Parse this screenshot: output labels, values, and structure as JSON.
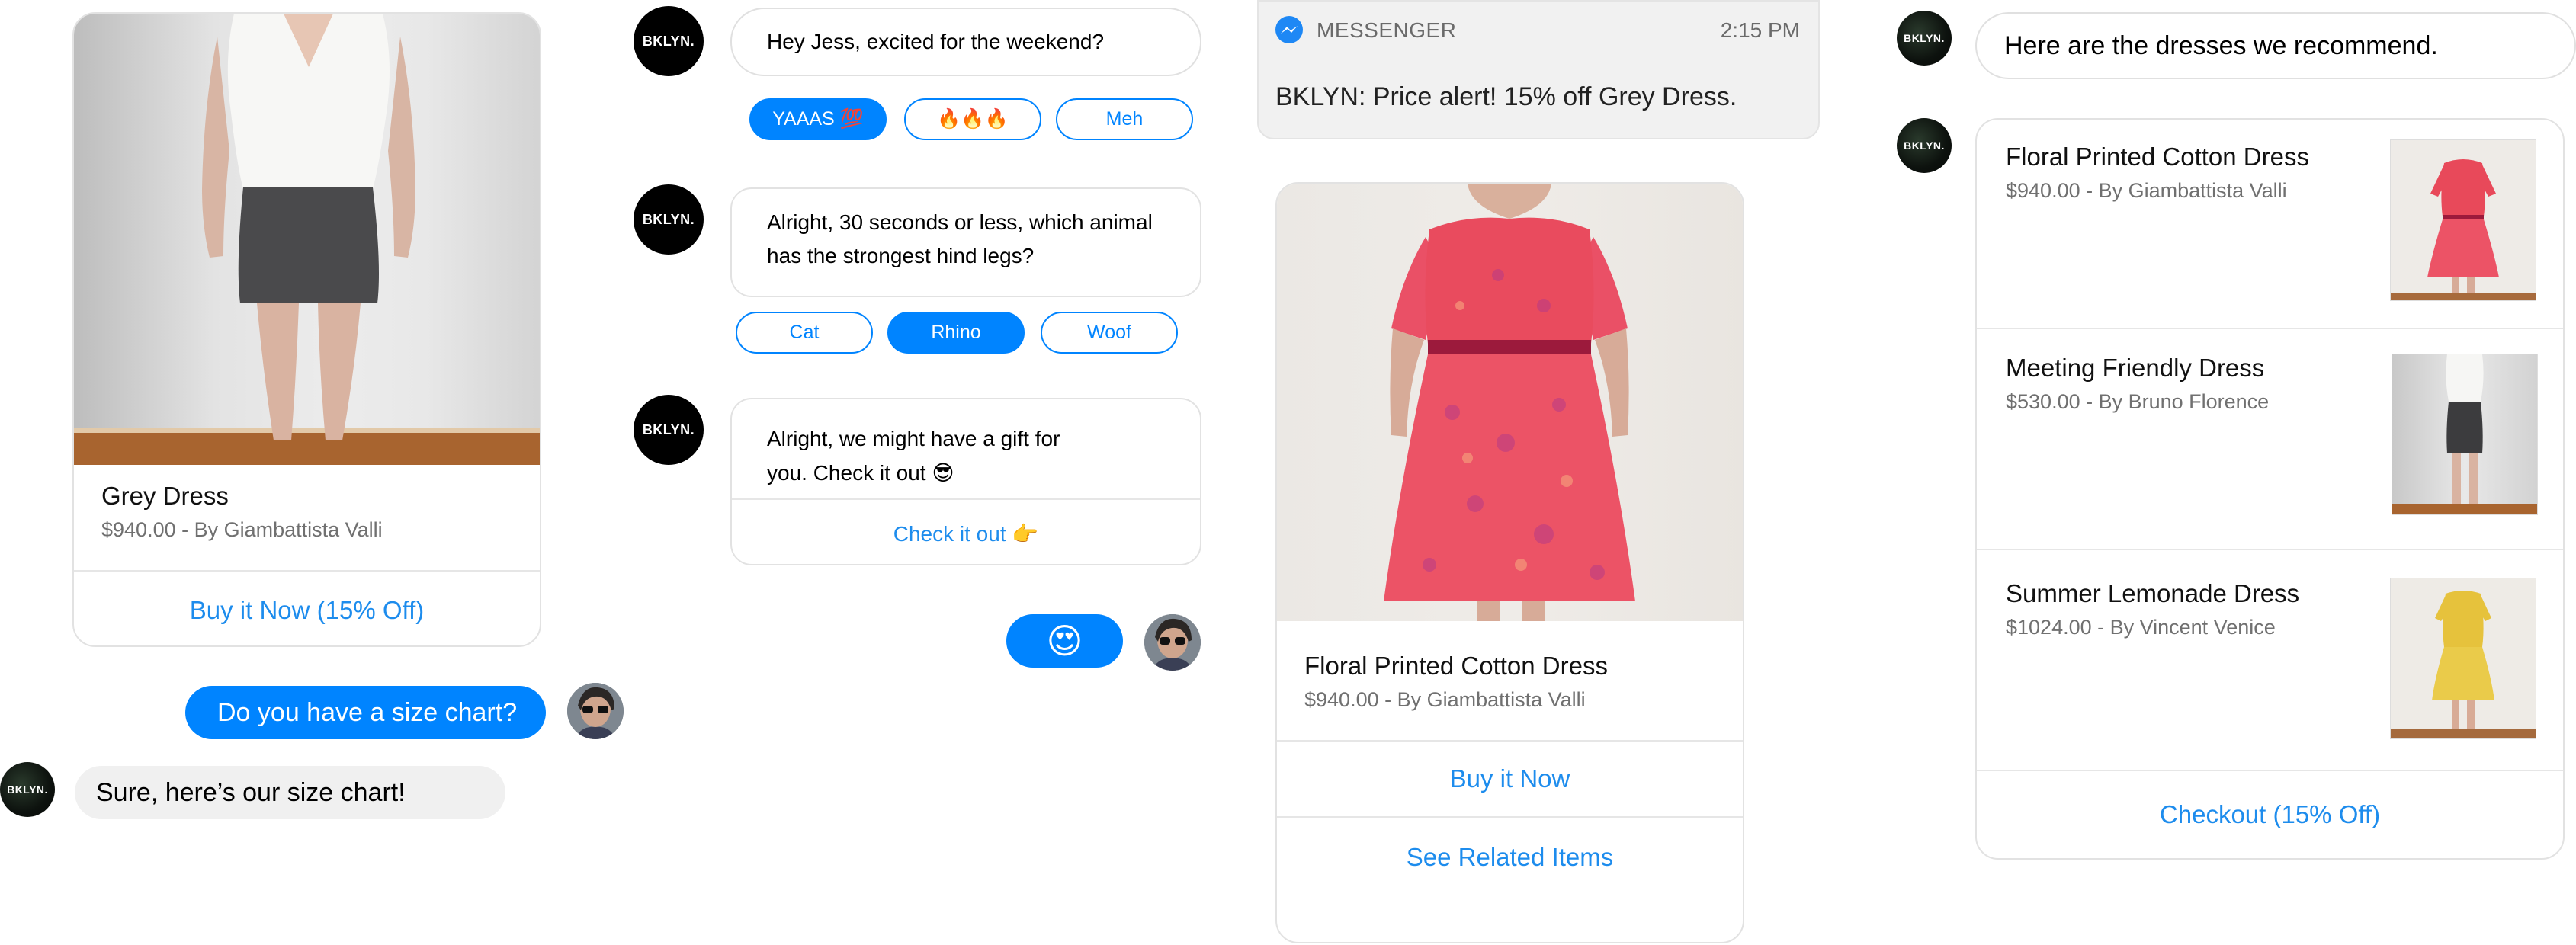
{
  "panel1": {
    "product_card": {
      "title": "Grey Dress",
      "subtitle": "$940.00 - By Giambattista Valli",
      "button": "Buy it Now (15% Off)"
    },
    "user_message": "Do you have a size chart?",
    "bot_reply": "Sure, here’s our size chart!",
    "bot_avatar_label": "BKLYN."
  },
  "panel2": {
    "bot_avatar_label": "BKLYN.",
    "message1": "Hey Jess, excited for the weekend?",
    "quick_replies1": [
      {
        "label": "YAAAS 💯",
        "selected": true
      },
      {
        "label": "🔥🔥🔥",
        "selected": false
      },
      {
        "label": "Meh",
        "selected": false
      }
    ],
    "message2_line1": "Alright, 30 seconds or less, which animal",
    "message2_line2": "has the strongest hind legs?",
    "quick_replies2": [
      {
        "label": "Cat",
        "selected": false
      },
      {
        "label": "Rhino",
        "selected": true
      },
      {
        "label": "Woof",
        "selected": false
      }
    ],
    "message3_line1": "Alright, we might have a gift for",
    "message3_line2": "you. Check it out 😎",
    "message3_button": "Check it out 👉",
    "user_reply": "😍"
  },
  "panel3": {
    "notification": {
      "app": "MESSENGER",
      "time": "2:15 PM",
      "text": "BKLYN: Price alert! 15% off Grey Dress."
    },
    "product_card": {
      "title": "Floral Printed Cotton Dress",
      "subtitle": "$940.00 - By Giambattista Valli",
      "button1": "Buy it Now",
      "button2": "See Related Items"
    }
  },
  "panel4": {
    "bot_avatar_label": "BKLYN.",
    "message": "Here are the dresses we recommend.",
    "list": [
      {
        "title": "Floral Printed Cotton Dress",
        "subtitle": "$940.00 - By Giambattista Valli",
        "color": "#e8495a"
      },
      {
        "title": "Meeting Friendly Dress",
        "subtitle": "$530.00 - By Bruno Florence",
        "color": "#3c3c3e"
      },
      {
        "title": "Summer Lemonade Dress",
        "subtitle": "$1024.00 - By Vincent Venice",
        "color": "#e6c23c"
      }
    ],
    "checkout_button": "Checkout (15% Off)"
  },
  "colors": {
    "messenger_blue": "#0084ff",
    "link_blue": "#1d8ced",
    "bubble_grey": "#f0f0f0",
    "border_grey": "#e2e2e2"
  }
}
